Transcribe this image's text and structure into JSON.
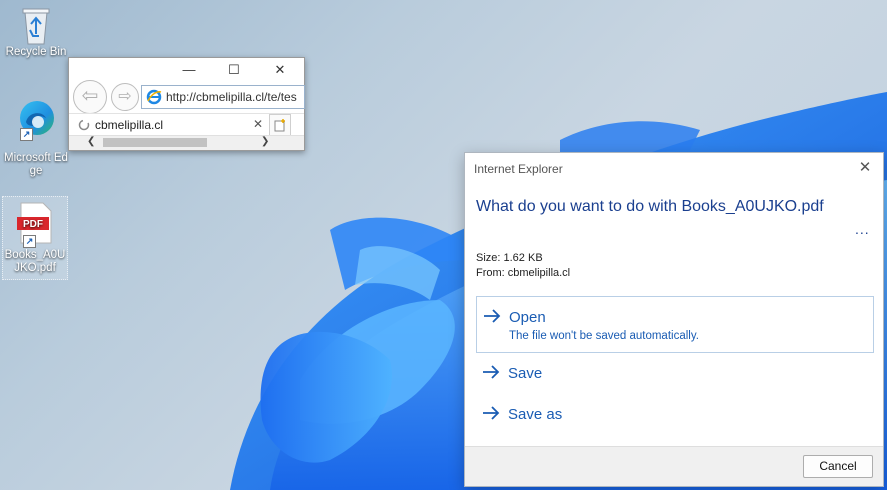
{
  "desktop": {
    "icons": [
      {
        "label": "Recycle Bin"
      },
      {
        "label": "Microsoft Edge"
      },
      {
        "label": "Books_A0UJKO.pdf",
        "thumb_text": "PDF"
      }
    ]
  },
  "ie_window": {
    "address": "http://cbmelipilla.cl/te/tes",
    "tab_title": "cbmelipilla.cl",
    "buttons": {
      "minimize": "—",
      "maximize": "☐",
      "close": "✕"
    }
  },
  "dialog": {
    "title": "Internet Explorer",
    "question": "What do you want to do with Books_A0UJKO.pdf",
    "more": "...",
    "size_line": "Size: 1.62 KB",
    "from_line": "From: cbmelipilla.cl",
    "options": [
      {
        "label": "Open",
        "sub": "The file won't be saved automatically."
      },
      {
        "label": "Save"
      },
      {
        "label": "Save as"
      }
    ],
    "cancel_label": "Cancel",
    "accent_color": "#1a5cb3"
  }
}
